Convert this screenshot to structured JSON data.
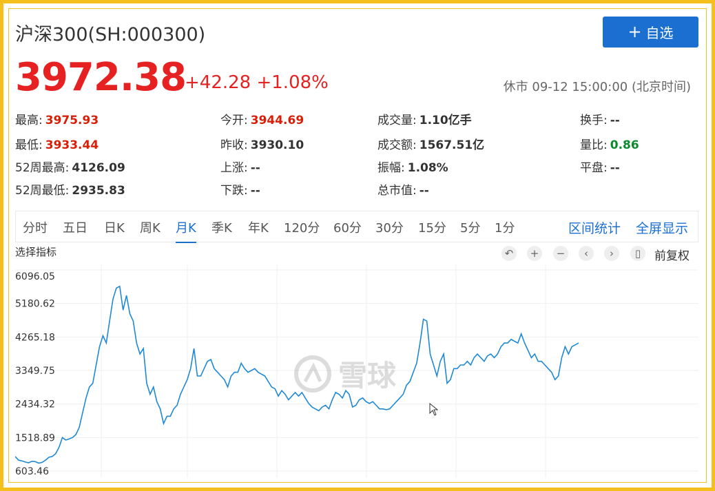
{
  "header": {
    "title": "沪深300(SH:000300)",
    "add_label": "自选"
  },
  "quote": {
    "price": "3972.38",
    "change": "+42.28",
    "change_pct": "+1.08%",
    "status": "休市 09-12 15:00:00 (北京时间)"
  },
  "stats": {
    "high_label": "最高:",
    "high": "3975.93",
    "low_label": "最低:",
    "low": "3933.44",
    "w52_high_label": "52周最高:",
    "w52_high": "4126.09",
    "w52_low_label": "52周最低:",
    "w52_low": "2935.83",
    "open_label": "今开:",
    "open": "3944.69",
    "prev_close_label": "昨收:",
    "prev_close": "3930.10",
    "up_label": "上涨:",
    "up": "--",
    "down_label": "下跌:",
    "down": "--",
    "volume_label": "成交量:",
    "volume": "1.10亿手",
    "amount_label": "成交额:",
    "amount": "1567.51亿",
    "amplitude_label": "振幅:",
    "amplitude": "1.08%",
    "market_cap_label": "总市值:",
    "market_cap": "--",
    "turnover_label": "换手:",
    "turnover": "--",
    "volume_ratio_label": "量比:",
    "volume_ratio": "0.86",
    "flat_label": "平盘:",
    "flat": "--"
  },
  "tabs": [
    "分时",
    "五日",
    "日K",
    "周K",
    "月K",
    "季K",
    "年K",
    "120分",
    "60分",
    "30分",
    "15分",
    "5分",
    "1分"
  ],
  "active_tab": "月K",
  "tab_actions": {
    "range_stats": "区间统计",
    "fullscreen": "全屏显示"
  },
  "toolbar": {
    "indicator_label": "选择指标",
    "adjust_label": "前复权",
    "tool_icons": [
      "undo-icon",
      "zoom-in-icon",
      "zoom-out-icon",
      "prev-icon",
      "next-icon",
      "candlestick-icon"
    ]
  },
  "watermark": {
    "text": "雪球"
  },
  "colors": {
    "up": "#e62121",
    "down": "#0a8a2a",
    "accent": "#1a6fd1",
    "line": "#1e88d6",
    "frame": "#f5c01e"
  },
  "chart_data": {
    "type": "line",
    "y_ticks": [
      "6096.05",
      "5180.62",
      "4265.18",
      "3349.75",
      "2434.32",
      "1518.89",
      "603.46"
    ],
    "ylim": [
      603.46,
      6096.05
    ],
    "grid": true,
    "series": [
      {
        "values": [
          1000,
          900,
          880,
          850,
          830,
          870,
          860,
          820,
          840,
          900,
          980,
          1000,
          1080,
          1250,
          1520,
          1450,
          1480,
          1520,
          1600,
          1800,
          2200,
          2600,
          2900,
          3000,
          3500,
          4000,
          4300,
          4100,
          4700,
          5300,
          5600,
          5650,
          5000,
          5400,
          4900,
          4700,
          4100,
          3800,
          3950,
          3000,
          2700,
          2900,
          2500,
          2300,
          1900,
          2100,
          2100,
          2300,
          2400,
          2700,
          2900,
          3100,
          3400,
          3950,
          3200,
          3200,
          3400,
          3600,
          3650,
          3400,
          3300,
          3200,
          3100,
          2900,
          3200,
          3300,
          3300,
          3550,
          3400,
          3300,
          3350,
          3400,
          3300,
          3250,
          3200,
          3050,
          2900,
          2850,
          2650,
          2800,
          2700,
          2550,
          2650,
          2750,
          2650,
          2750,
          2600,
          2450,
          2350,
          2300,
          2250,
          2350,
          2400,
          2300,
          2550,
          2750,
          2700,
          2600,
          2800,
          2700,
          2350,
          2400,
          2550,
          2600,
          2500,
          2450,
          2500,
          2400,
          2300,
          2300,
          2280,
          2300,
          2400,
          2500,
          2600,
          2700,
          2950,
          3050,
          3300,
          3550,
          4100,
          4750,
          4700,
          3800,
          3500,
          3200,
          3600,
          3800,
          3000,
          3100,
          3400,
          3400,
          3500,
          3500,
          3600,
          3500,
          3700,
          3800,
          3700,
          3600,
          3750,
          3800,
          3700,
          3800,
          4000,
          4100,
          4100,
          4200,
          4150,
          4100,
          4350,
          4100,
          3900,
          3700,
          3800,
          3600,
          3600,
          3500,
          3400,
          3300,
          3100,
          3200,
          3700,
          4000,
          3800,
          4000,
          4050,
          4100
        ]
      }
    ]
  }
}
